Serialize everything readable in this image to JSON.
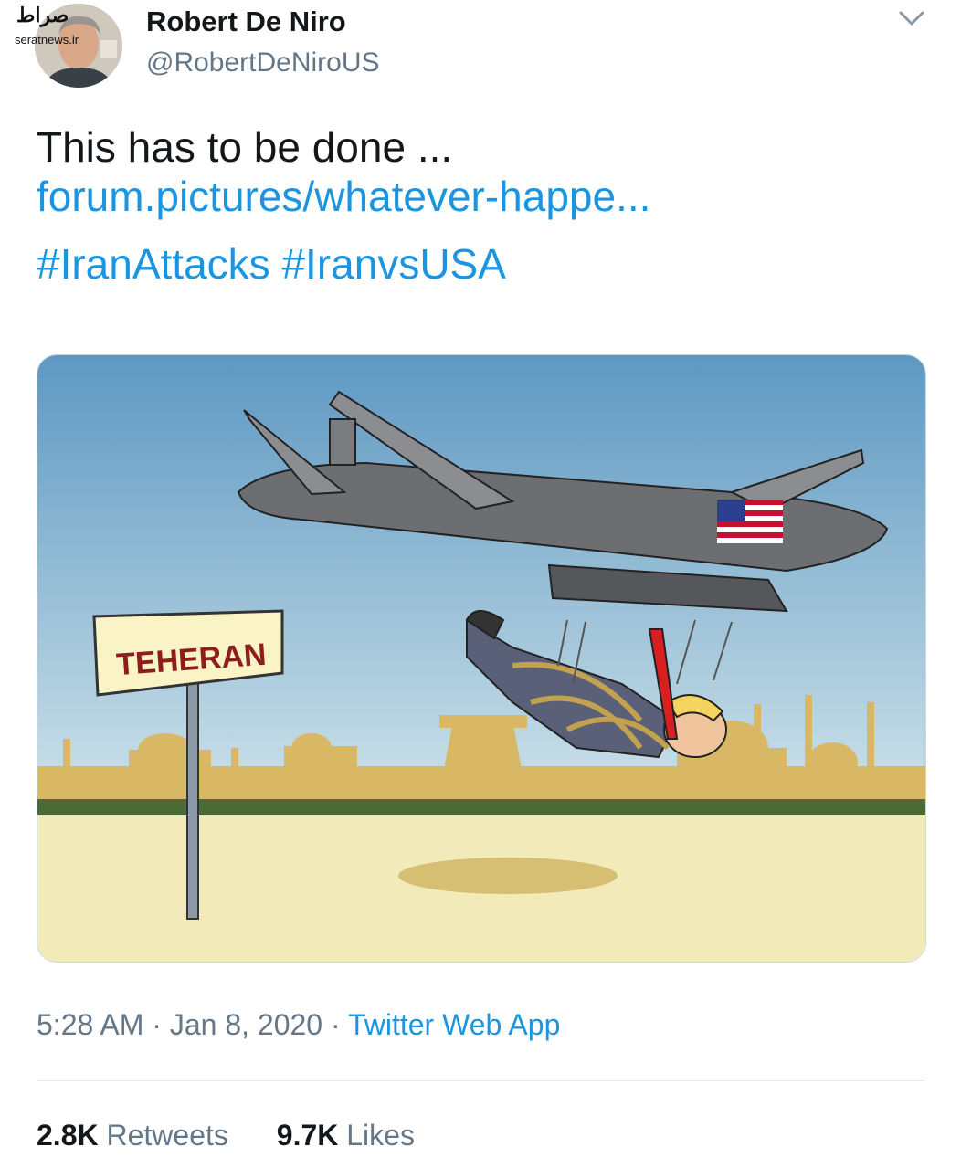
{
  "watermark": {
    "logo": "صراط",
    "site": "seratnews.ir"
  },
  "author": {
    "name": "Robert De Niro",
    "handle": "@RobertDeNiroUS"
  },
  "tweet": {
    "text": "This has to be done ...",
    "link": "forum.pictures/whatever-happe...",
    "hashtags": [
      "#IranAttacks",
      "#IranvsUSA"
    ]
  },
  "image": {
    "sign_text": "TEHERAN"
  },
  "meta": {
    "time": "5:28 AM",
    "sep1": "·",
    "date": "Jan 8, 2020",
    "sep2": "·",
    "source": "Twitter Web App"
  },
  "stats": {
    "retweets_count": "2.8K",
    "retweets_label": "Retweets",
    "likes_count": "9.7K",
    "likes_label": "Likes"
  },
  "colors": {
    "link": "#1b95e0",
    "muted": "#657786",
    "text": "#14171a",
    "sky": "#6da4c8",
    "sand": "#f4ebc0",
    "skyline": "#d9b866"
  },
  "icons": {
    "menu": "chevron-down-icon"
  }
}
